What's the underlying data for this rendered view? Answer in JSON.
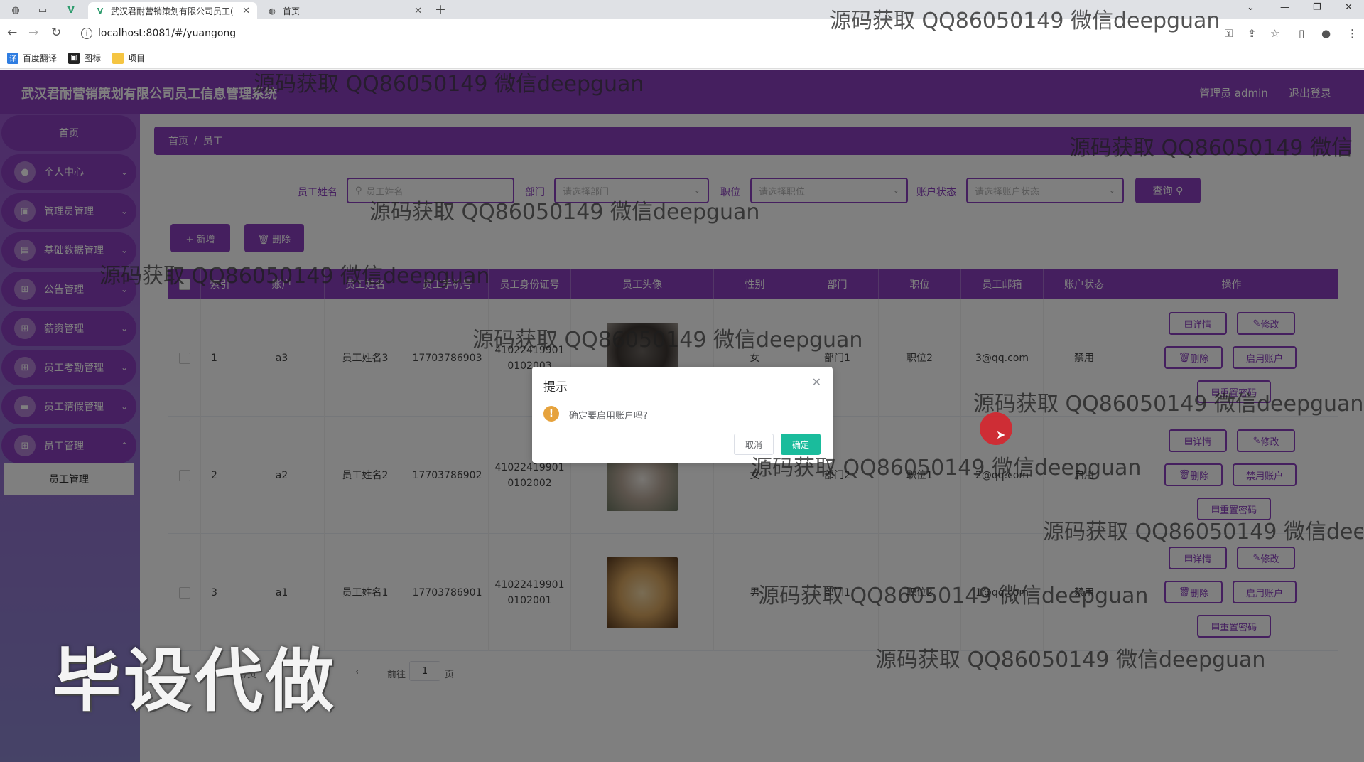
{
  "browser": {
    "tabs": [
      {
        "title": "武汉君耐营销策划有限公司员工(",
        "active": true
      },
      {
        "title": "首页",
        "active": false
      }
    ],
    "url": "localhost:8081/#/yuangong",
    "bookmarks": [
      "百度翻译",
      "图标",
      "项目"
    ]
  },
  "header": {
    "title": "武汉君耐营销策划有限公司员工信息管理系统",
    "admin_label": "管理员 admin",
    "logout_label": "退出登录"
  },
  "sidebar": {
    "home": "首页",
    "items": [
      {
        "label": "个人中心",
        "icon": "user-icon"
      },
      {
        "label": "管理员管理",
        "icon": "admin-icon"
      },
      {
        "label": "基础数据管理",
        "icon": "data-icon"
      },
      {
        "label": "公告管理",
        "icon": "grid-icon"
      },
      {
        "label": "薪资管理",
        "icon": "grid-icon"
      },
      {
        "label": "员工考勤管理",
        "icon": "grid-icon"
      },
      {
        "label": "员工请假管理",
        "icon": "chat-icon"
      },
      {
        "label": "员工管理",
        "icon": "grid-icon"
      }
    ],
    "active_sub": "员工管理"
  },
  "breadcrumb": {
    "home": "首页",
    "separator": "/",
    "current": "员工"
  },
  "search": {
    "name_label": "员工姓名",
    "name_placeholder": "员工姓名",
    "dept_label": "部门",
    "dept_placeholder": "请选择部门",
    "position_label": "职位",
    "position_placeholder": "请选择职位",
    "status_label": "账户状态",
    "status_placeholder": "请选择账户状态",
    "query_label": "查询 ⚲"
  },
  "actions": {
    "add_label": "+ 新增",
    "delete_label": "🗑 删除"
  },
  "table": {
    "headers": [
      "索引",
      "账户",
      "员工姓名",
      "员工手机号",
      "员工身份证号",
      "员工头像",
      "性别",
      "部门",
      "职位",
      "员工邮箱",
      "账户状态",
      "操作"
    ],
    "rows": [
      {
        "index": "1",
        "account": "a3",
        "name": "员工姓名3",
        "phone": "17703786903",
        "id1": "41022419901",
        "id2": "0102003",
        "gender": "女",
        "dept": "部门1",
        "position": "职位2",
        "email": "3@qq.com",
        "status": "禁用",
        "toggle": "启用账户"
      },
      {
        "index": "2",
        "account": "a2",
        "name": "员工姓名2",
        "phone": "17703786902",
        "id1": "41022419901",
        "id2": "0102002",
        "gender": "女",
        "dept": "部门2",
        "position": "职位1",
        "email": "2@qq.com",
        "status": "启用",
        "toggle": "禁用账户"
      },
      {
        "index": "3",
        "account": "a1",
        "name": "员工姓名1",
        "phone": "17703786901",
        "id1": "41022419901",
        "id2": "0102001",
        "gender": "男",
        "dept": "部门1",
        "position": "职位2",
        "email": "1@qq.com",
        "status": "禁用",
        "toggle": "启用账户"
      }
    ],
    "op_labels": {
      "detail": "详情",
      "edit": "修改",
      "delete": "删除",
      "reset": "重置密码"
    }
  },
  "pagination": {
    "per_page": "10条/页",
    "goto": "前往",
    "page": "1",
    "page_suffix": "页"
  },
  "dialog": {
    "title": "提示",
    "message": "确定要启用账户吗?",
    "cancel": "取消",
    "confirm": "确定"
  },
  "watermark": {
    "text": "源码获取 QQ86050149 微信deepguan",
    "big": "毕设代做"
  },
  "colors": {
    "accent": "#8a3fbf",
    "confirm": "#1abc9c",
    "warning": "#e6a23c"
  }
}
